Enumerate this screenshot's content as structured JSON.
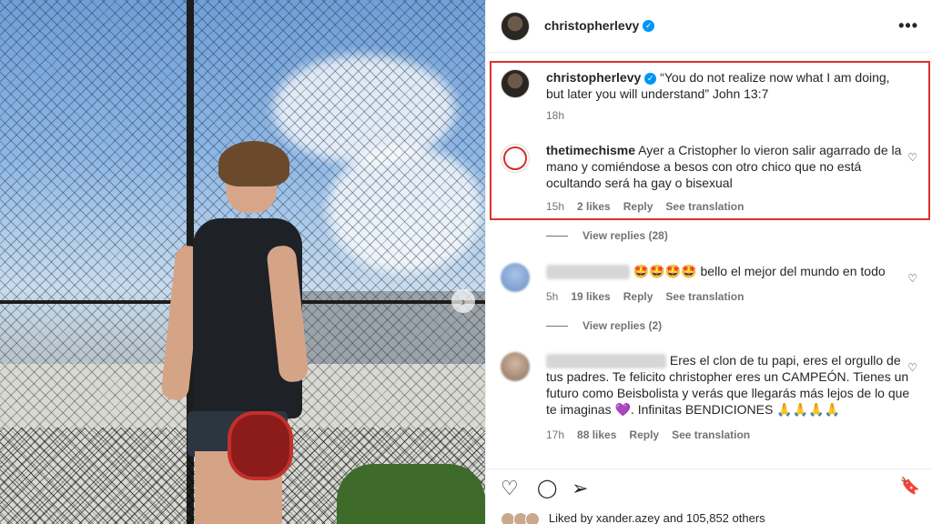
{
  "post": {
    "author": "christopherlevy",
    "carousel_next": "›"
  },
  "header": {
    "username": "christopherlevy",
    "verified_mark": "✓",
    "more": "•••"
  },
  "caption": {
    "username": "christopherlevy",
    "verified_mark": "✓",
    "text": "“You do not realize now what I am doing, but later you will understand” John 13:7",
    "time": "18h"
  },
  "comments": [
    {
      "username": "thetimechisme",
      "text": "Ayer a Cristopher lo vieron salir agarrado de la mano y comiéndose a besos con otro chico que no está ocultando será ha gay o bisexual",
      "time": "15h",
      "likes": "2 likes",
      "reply": "Reply",
      "translate": "See translation",
      "view_replies": "View replies (28)",
      "heart": "♡"
    },
    {
      "username": "",
      "text": "🤩🤩🤩🤩 bello el mejor del mundo en todo",
      "time": "5h",
      "likes": "19 likes",
      "reply": "Reply",
      "translate": "See translation",
      "view_replies": "View replies (2)",
      "heart": "♡"
    },
    {
      "username": "",
      "text": "Eres el clon de tu papi, eres el orgullo de tus padres. Te felicito christopher eres un CAMPEÓN. Tienes un futuro como Beisbolista y verás que llegarás más lejos de lo que te imaginas 💜. Infinitas BENDICIONES 🙏🙏🙏🙏",
      "time": "17h",
      "likes": "88 likes",
      "reply": "Reply",
      "translate": "See translation",
      "heart": "♡"
    }
  ],
  "actions": {
    "like": "♡",
    "comment": "◯",
    "share": "➢",
    "save": "🔖"
  },
  "liked_by": "Liked by xander.azey and 105,852 others"
}
